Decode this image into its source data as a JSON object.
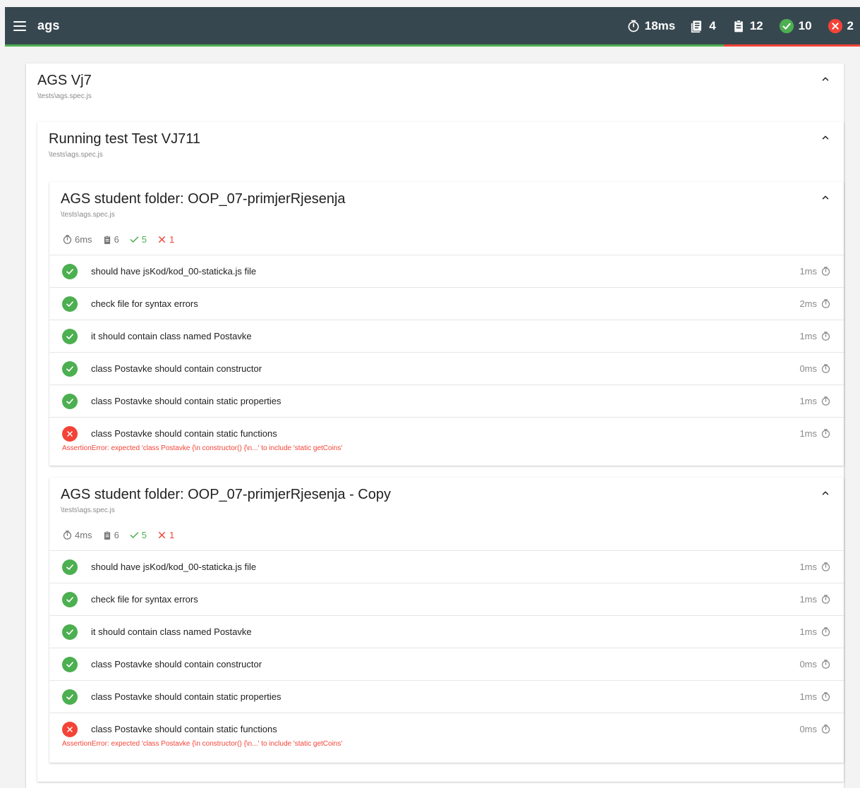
{
  "header": {
    "title": "ags",
    "duration": "18ms",
    "suites": "4",
    "tests": "12",
    "passed": "10",
    "failed": "2"
  },
  "colors": {
    "topbar": "#37474f",
    "pass": "#4caf50",
    "fail": "#f44336",
    "page_background": "#f3f3f3"
  },
  "outer": {
    "title": "AGS Vj7",
    "path": "\\tests\\ags.spec.js"
  },
  "inner": {
    "title": "Running test Test VJ711",
    "path": "\\tests\\ags.spec.js"
  },
  "folders": [
    {
      "title": "AGS student folder: OOP_07-primjerRjesenja",
      "path": "\\tests\\ags.spec.js",
      "stats": {
        "duration": "6ms",
        "tests": "6",
        "passed": "5",
        "failed": "1"
      },
      "tests": [
        {
          "name": "should have jsKod/kod_00-staticka.js file",
          "time": "1ms",
          "status": "pass"
        },
        {
          "name": "check file for syntax errors",
          "time": "2ms",
          "status": "pass"
        },
        {
          "name": "it should contain class named Postavke",
          "time": "1ms",
          "status": "pass"
        },
        {
          "name": "class Postavke should contain constructor",
          "time": "0ms",
          "status": "pass"
        },
        {
          "name": "class Postavke should contain static properties",
          "time": "1ms",
          "status": "pass"
        },
        {
          "name": "class Postavke should contain static functions",
          "time": "1ms",
          "status": "fail",
          "error": "AssertionError: expected 'class Postavke {\\n constructor() {\\n...' to include 'static getCoins'"
        }
      ]
    },
    {
      "title": "AGS student folder: OOP_07-primjerRjesenja - Copy",
      "path": "\\tests\\ags.spec.js",
      "stats": {
        "duration": "4ms",
        "tests": "6",
        "passed": "5",
        "failed": "1"
      },
      "tests": [
        {
          "name": "should have jsKod/kod_00-staticka.js file",
          "time": "1ms",
          "status": "pass"
        },
        {
          "name": "check file for syntax errors",
          "time": "1ms",
          "status": "pass"
        },
        {
          "name": "it should contain class named Postavke",
          "time": "1ms",
          "status": "pass"
        },
        {
          "name": "class Postavke should contain constructor",
          "time": "0ms",
          "status": "pass"
        },
        {
          "name": "class Postavke should contain static properties",
          "time": "1ms",
          "status": "pass"
        },
        {
          "name": "class Postavke should contain static functions",
          "time": "0ms",
          "status": "fail",
          "error": "AssertionError: expected 'class Postavke {\\n constructor() {\\n...' to include 'static getCoins'"
        }
      ]
    }
  ]
}
